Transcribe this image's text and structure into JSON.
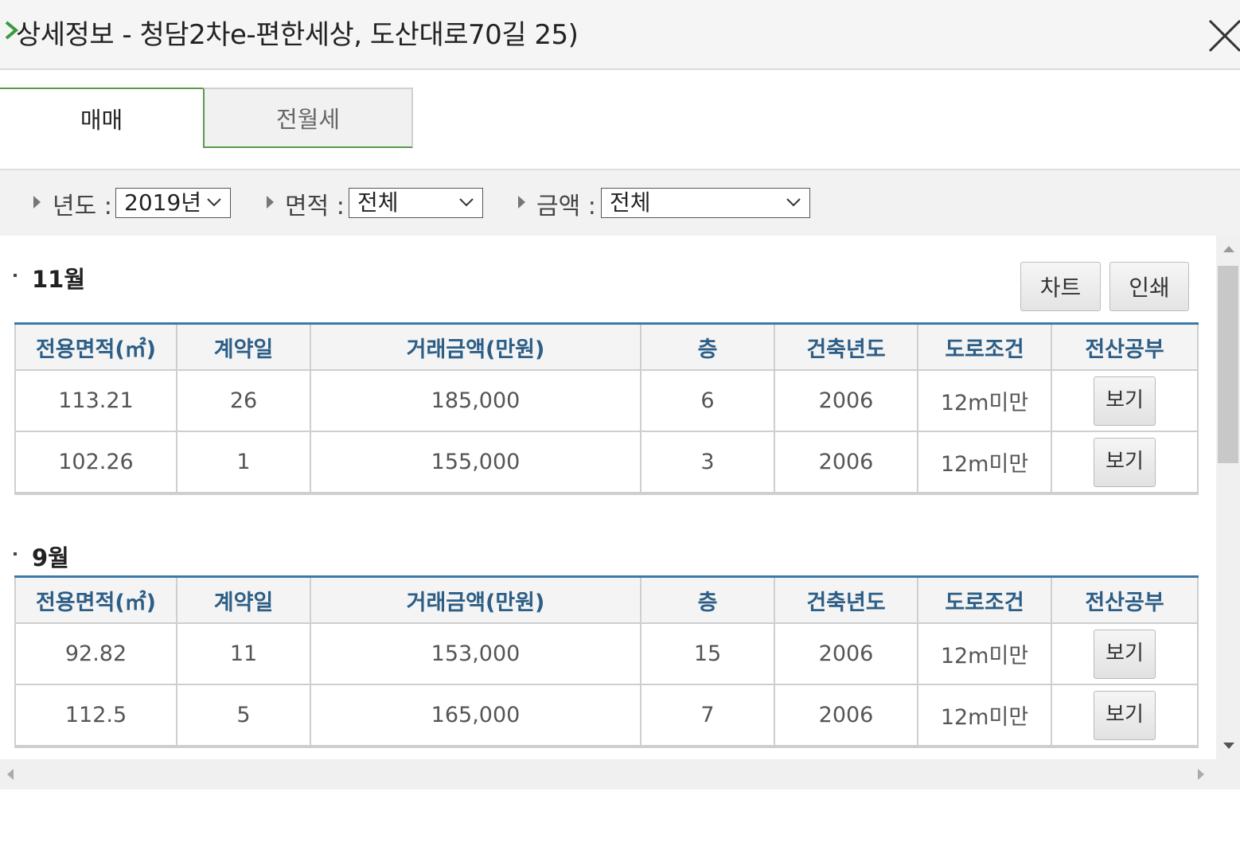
{
  "window": {
    "title": "상세정보 - 청담2차e-편한세상, 도산대로70길 25)"
  },
  "tabs": [
    {
      "label": "매매",
      "active": true
    },
    {
      "label": "전월세",
      "active": false
    }
  ],
  "filters": {
    "year": {
      "label": "년도 :",
      "value": "2019년"
    },
    "area": {
      "label": "면적 :",
      "value": "전체"
    },
    "price": {
      "label": "금액 :",
      "value": "전체"
    }
  },
  "actions": {
    "chart_label": "차트",
    "print_label": "인쇄"
  },
  "columns": [
    "전용면적(㎡)",
    "계약일",
    "거래금액(만원)",
    "층",
    "건축년도",
    "도로조건",
    "전산공부"
  ],
  "months": [
    {
      "title": "11월",
      "rows": [
        {
          "area": "113.21",
          "day": "26",
          "price": "185,000",
          "floor": "6",
          "year": "2006",
          "road": "12m미만",
          "view": "보기"
        },
        {
          "area": "102.26",
          "day": "1",
          "price": "155,000",
          "floor": "3",
          "year": "2006",
          "road": "12m미만",
          "view": "보기"
        }
      ]
    },
    {
      "title": "9월",
      "rows": [
        {
          "area": "92.82",
          "day": "11",
          "price": "153,000",
          "floor": "15",
          "year": "2006",
          "road": "12m미만",
          "view": "보기"
        },
        {
          "area": "112.5",
          "day": "5",
          "price": "165,000",
          "floor": "7",
          "year": "2006",
          "road": "12m미만",
          "view": "보기"
        }
      ]
    }
  ],
  "colors": {
    "accent_green": "#5a9a4a",
    "header_blue": "#2d5e86",
    "table_top_border": "#3d79a8"
  }
}
